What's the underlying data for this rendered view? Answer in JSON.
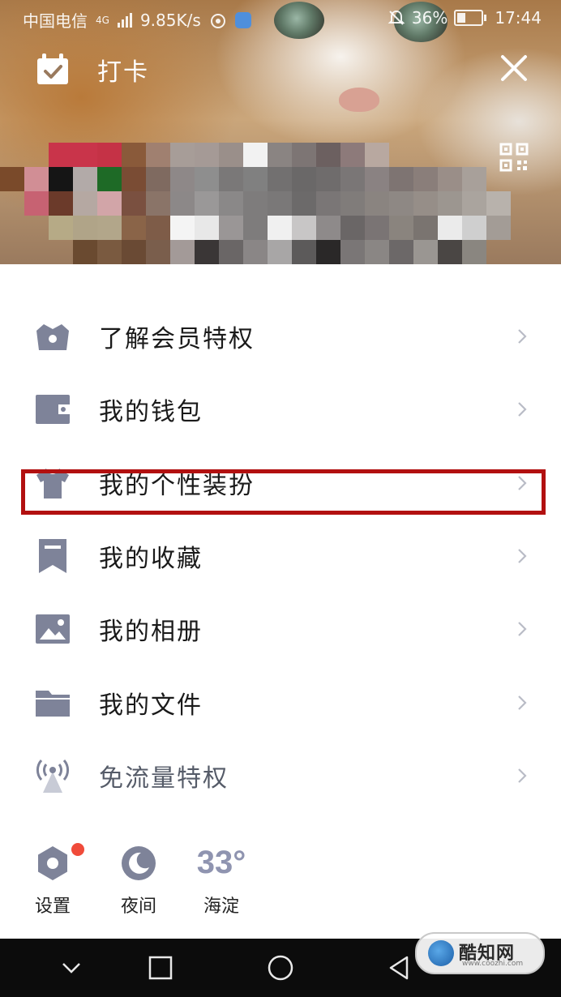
{
  "status_bar": {
    "carrier": "中国电信",
    "network": "4G",
    "speed": "9.85K/s",
    "battery_percent": "36%",
    "battery_level": 0.36,
    "time": "17:44",
    "icons": [
      "signal-icon",
      "weibo-icon",
      "app-icon",
      "mute-bell-icon",
      "battery-icon"
    ]
  },
  "header": {
    "punch_label": "打卡",
    "punch_icon": "calendar-check-icon",
    "close_icon": "close-icon",
    "qr_icon": "qr-code-icon"
  },
  "menu": {
    "items": [
      {
        "label": "了解会员特权",
        "icon": "crown-icon"
      },
      {
        "label": "我的钱包",
        "icon": "wallet-icon"
      },
      {
        "label": "我的个性装扮",
        "icon": "tshirt-icon"
      },
      {
        "label": "我的收藏",
        "icon": "bookmark-icon"
      },
      {
        "label": "我的相册",
        "icon": "photo-icon"
      },
      {
        "label": "我的文件",
        "icon": "folder-icon"
      },
      {
        "label": "免流量特权",
        "icon": "antenna-icon"
      }
    ],
    "highlighted_item": "我的个性装扮"
  },
  "tools": {
    "settings_label": "设置",
    "night_label": "夜间",
    "weather_temp": "33°",
    "weather_location": "海淀"
  },
  "watermark": {
    "text": "酷知网",
    "sub": "www.coozhi.com"
  },
  "colors": {
    "icon_gray": "#7e8399",
    "highlight_red": "#b21010",
    "badge_red": "#f04b3a",
    "nav_bar": "#0c0c0c"
  }
}
